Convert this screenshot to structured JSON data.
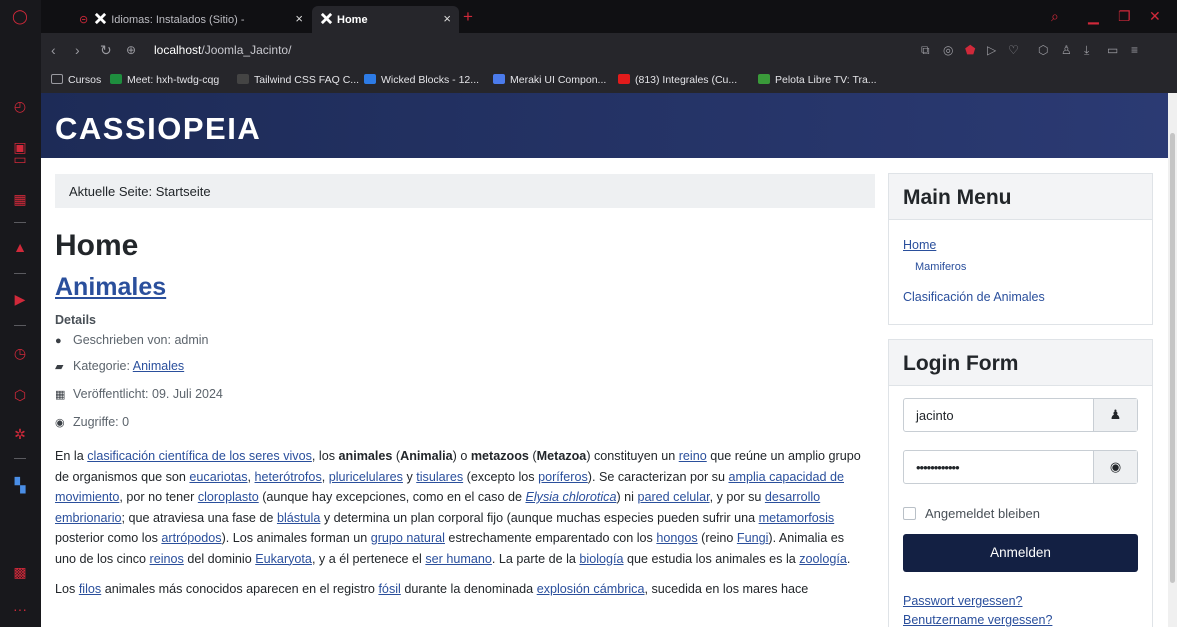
{
  "browser": {
    "tabs": [
      {
        "title": "Idiomas: Instalados (Sitio) -",
        "close": "×"
      },
      {
        "title": "Home",
        "close": "×"
      }
    ],
    "new_tab": "+",
    "url_host": "localhost",
    "url_path": "/Joomla_Jacinto/",
    "bookmarks": [
      {
        "label": "Cursos",
        "icon_color": "#9a9aa0"
      },
      {
        "label": "Meet: hxh-twdg-cqg",
        "icon_color": "#1e8e3e"
      },
      {
        "label": "Tailwind CSS FAQ C...",
        "icon_color": "#ffffff"
      },
      {
        "label": "Wicked Blocks - 12...",
        "icon_color": "#2d7be6"
      },
      {
        "label": "Meraki UI Compon...",
        "icon_color": "#4b7bec"
      },
      {
        "label": "(813) Integrales (Cu...",
        "icon_color": "#e21b1b"
      },
      {
        "label": "Pelota Libre TV: Tra...",
        "icon_color": "#3a9a3a"
      }
    ]
  },
  "site": {
    "brand": "CASSIOPEIA",
    "breadcrumb": "Aktuelle Seite:  Startseite",
    "page_title": "Home",
    "article_title": "Animales",
    "details_label": "Details",
    "meta": {
      "author": "Geschrieben von: admin",
      "category_prefix": "Kategorie: ",
      "category": "Animales",
      "published": "Veröffentlicht: 09. Juli 2024",
      "hits": "Zugriffe: 0"
    }
  },
  "article": {
    "p1": [
      {
        "t": "En la "
      },
      {
        "a": "clasificación científica de los seres vivos"
      },
      {
        "t": ", los "
      },
      {
        "b": "animales"
      },
      {
        "t": " ("
      },
      {
        "b": "Animalia"
      },
      {
        "t": ") o "
      },
      {
        "b": "metazoos"
      },
      {
        "t": " ("
      },
      {
        "b": "Metazoa"
      },
      {
        "t": ") constituyen un "
      },
      {
        "a": "reino"
      },
      {
        "t": " que reúne un amplio grupo de organismos que son "
      },
      {
        "a": "eucariotas"
      },
      {
        "t": ", "
      },
      {
        "a": "heterótrofos"
      },
      {
        "t": ", "
      },
      {
        "a": "pluricelulares"
      },
      {
        "t": " y "
      },
      {
        "a": "tisulares"
      },
      {
        "t": " (excepto los "
      },
      {
        "a": "poríferos"
      },
      {
        "t": "). Se caracterizan por su "
      },
      {
        "a": "amplia capacidad de movimiento"
      },
      {
        "t": ", por no tener "
      },
      {
        "a": "cloroplasto"
      },
      {
        "t": " (aunque hay excepciones, como en el caso de "
      },
      {
        "ai": "Elysia chlorotica"
      },
      {
        "t": ") ni "
      },
      {
        "a": "pared celular"
      },
      {
        "t": ", y por su "
      },
      {
        "a": "desarrollo embrionario"
      },
      {
        "t": "; que atraviesa una fase de "
      },
      {
        "a": "blástula"
      },
      {
        "t": " y determina un plan corporal fijo (aunque muchas especies pueden sufrir una "
      },
      {
        "a": "metamorfosis"
      },
      {
        "t": " posterior como los "
      },
      {
        "a": "artrópodos"
      },
      {
        "t": "). Los animales forman un "
      },
      {
        "a": "grupo natural"
      },
      {
        "t": " estrechamente emparentado con los "
      },
      {
        "a": "hongos"
      },
      {
        "t": " (reino "
      },
      {
        "a": "Fungi"
      },
      {
        "t": "). Animalia es uno de los cinco "
      },
      {
        "a": "reinos"
      },
      {
        "t": " del dominio "
      },
      {
        "a": "Eukaryota"
      },
      {
        "t": ", y a él pertenece el "
      },
      {
        "a": "ser humano"
      },
      {
        "t": ". La parte de la "
      },
      {
        "a": "biología"
      },
      {
        "t": " que estudia los animales es la "
      },
      {
        "a": "zoología"
      },
      {
        "t": "."
      }
    ],
    "p2": [
      {
        "t": "Los "
      },
      {
        "a": "filos"
      },
      {
        "t": " animales más conocidos aparecen en el registro "
      },
      {
        "a": "fósil"
      },
      {
        "t": " durante la denominada "
      },
      {
        "a": "explosión cámbrica"
      },
      {
        "t": ", sucedida en los mares hace"
      }
    ]
  },
  "sidebar": {
    "menu_title": "Main Menu",
    "menu_items": [
      "Home",
      "Mamiferos",
      "Clasificación de Animales"
    ],
    "login_title": "Login Form",
    "username_value": "jacinto",
    "password_value": "••••••••••••",
    "remember_label": "Angemeldet bleiben",
    "login_button": "Anmelden",
    "forgot_password": "Passwort vergessen?",
    "forgot_username": "Benutzername vergessen?"
  }
}
